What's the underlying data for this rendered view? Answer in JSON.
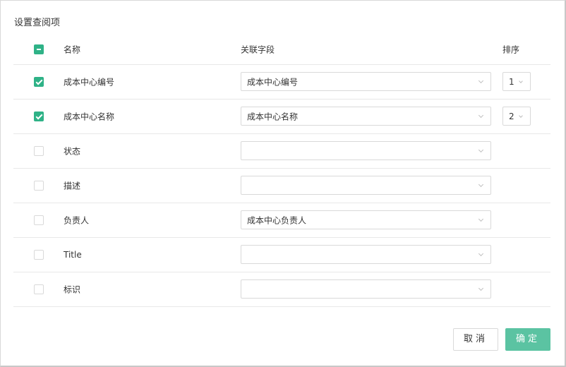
{
  "dialog": {
    "title": "设置查阅项",
    "header": {
      "name": "名称",
      "field": "关联字段",
      "order": "排序",
      "select_all_state": "indeterminate"
    },
    "rows": [
      {
        "checked": true,
        "name": "成本中心编号",
        "field": "成本中心编号",
        "order": "1"
      },
      {
        "checked": true,
        "name": "成本中心名称",
        "field": "成本中心名称",
        "order": "2"
      },
      {
        "checked": false,
        "name": "状态",
        "field": ""
      },
      {
        "checked": false,
        "name": "描述",
        "field": ""
      },
      {
        "checked": false,
        "name": "负责人",
        "field": "成本中心负责人"
      },
      {
        "checked": false,
        "name": "Title",
        "field": ""
      },
      {
        "checked": false,
        "name": "标识",
        "field": ""
      }
    ],
    "buttons": {
      "cancel": "取消",
      "ok": "确定"
    }
  },
  "colors": {
    "accent": "#2fb287",
    "ok_button": "#5bc3a2",
    "border": "#d9d9d9"
  },
  "icons": {
    "dropdown": "chevron-down-icon",
    "check": "check-icon"
  }
}
